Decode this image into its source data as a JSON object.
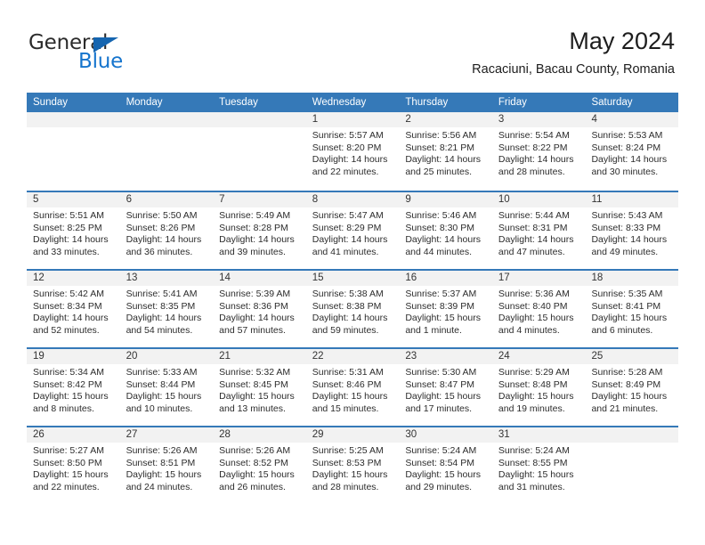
{
  "brand": {
    "name_top": "General",
    "name_bottom": "Blue",
    "triangle_color": "#1565b0",
    "blue_color": "#1574cd"
  },
  "header": {
    "title": "May 2024",
    "subtitle": "Racaciuni, Bacau County, Romania"
  },
  "theme": {
    "header_blue": "#3579b8",
    "daynum_band": "#f2f2f2",
    "text": "#2c2c2c"
  },
  "labels": {
    "sunrise_prefix": "Sunrise: ",
    "sunset_prefix": "Sunset: ",
    "daylight_prefix": "Daylight: "
  },
  "weekdays": [
    "Sunday",
    "Monday",
    "Tuesday",
    "Wednesday",
    "Thursday",
    "Friday",
    "Saturday"
  ],
  "weeks": [
    [
      {
        "day": "",
        "empty": true
      },
      {
        "day": "",
        "empty": true
      },
      {
        "day": "",
        "empty": true
      },
      {
        "day": "1",
        "sunrise": "Sunrise: 5:57 AM",
        "sunset": "Sunset: 8:20 PM",
        "daylight": "Daylight: 14 hours and 22 minutes."
      },
      {
        "day": "2",
        "sunrise": "Sunrise: 5:56 AM",
        "sunset": "Sunset: 8:21 PM",
        "daylight": "Daylight: 14 hours and 25 minutes."
      },
      {
        "day": "3",
        "sunrise": "Sunrise: 5:54 AM",
        "sunset": "Sunset: 8:22 PM",
        "daylight": "Daylight: 14 hours and 28 minutes."
      },
      {
        "day": "4",
        "sunrise": "Sunrise: 5:53 AM",
        "sunset": "Sunset: 8:24 PM",
        "daylight": "Daylight: 14 hours and 30 minutes."
      }
    ],
    [
      {
        "day": "5",
        "sunrise": "Sunrise: 5:51 AM",
        "sunset": "Sunset: 8:25 PM",
        "daylight": "Daylight: 14 hours and 33 minutes."
      },
      {
        "day": "6",
        "sunrise": "Sunrise: 5:50 AM",
        "sunset": "Sunset: 8:26 PM",
        "daylight": "Daylight: 14 hours and 36 minutes."
      },
      {
        "day": "7",
        "sunrise": "Sunrise: 5:49 AM",
        "sunset": "Sunset: 8:28 PM",
        "daylight": "Daylight: 14 hours and 39 minutes."
      },
      {
        "day": "8",
        "sunrise": "Sunrise: 5:47 AM",
        "sunset": "Sunset: 8:29 PM",
        "daylight": "Daylight: 14 hours and 41 minutes."
      },
      {
        "day": "9",
        "sunrise": "Sunrise: 5:46 AM",
        "sunset": "Sunset: 8:30 PM",
        "daylight": "Daylight: 14 hours and 44 minutes."
      },
      {
        "day": "10",
        "sunrise": "Sunrise: 5:44 AM",
        "sunset": "Sunset: 8:31 PM",
        "daylight": "Daylight: 14 hours and 47 minutes."
      },
      {
        "day": "11",
        "sunrise": "Sunrise: 5:43 AM",
        "sunset": "Sunset: 8:33 PM",
        "daylight": "Daylight: 14 hours and 49 minutes."
      }
    ],
    [
      {
        "day": "12",
        "sunrise": "Sunrise: 5:42 AM",
        "sunset": "Sunset: 8:34 PM",
        "daylight": "Daylight: 14 hours and 52 minutes."
      },
      {
        "day": "13",
        "sunrise": "Sunrise: 5:41 AM",
        "sunset": "Sunset: 8:35 PM",
        "daylight": "Daylight: 14 hours and 54 minutes."
      },
      {
        "day": "14",
        "sunrise": "Sunrise: 5:39 AM",
        "sunset": "Sunset: 8:36 PM",
        "daylight": "Daylight: 14 hours and 57 minutes."
      },
      {
        "day": "15",
        "sunrise": "Sunrise: 5:38 AM",
        "sunset": "Sunset: 8:38 PM",
        "daylight": "Daylight: 14 hours and 59 minutes."
      },
      {
        "day": "16",
        "sunrise": "Sunrise: 5:37 AM",
        "sunset": "Sunset: 8:39 PM",
        "daylight": "Daylight: 15 hours and 1 minute."
      },
      {
        "day": "17",
        "sunrise": "Sunrise: 5:36 AM",
        "sunset": "Sunset: 8:40 PM",
        "daylight": "Daylight: 15 hours and 4 minutes."
      },
      {
        "day": "18",
        "sunrise": "Sunrise: 5:35 AM",
        "sunset": "Sunset: 8:41 PM",
        "daylight": "Daylight: 15 hours and 6 minutes."
      }
    ],
    [
      {
        "day": "19",
        "sunrise": "Sunrise: 5:34 AM",
        "sunset": "Sunset: 8:42 PM",
        "daylight": "Daylight: 15 hours and 8 minutes."
      },
      {
        "day": "20",
        "sunrise": "Sunrise: 5:33 AM",
        "sunset": "Sunset: 8:44 PM",
        "daylight": "Daylight: 15 hours and 10 minutes."
      },
      {
        "day": "21",
        "sunrise": "Sunrise: 5:32 AM",
        "sunset": "Sunset: 8:45 PM",
        "daylight": "Daylight: 15 hours and 13 minutes."
      },
      {
        "day": "22",
        "sunrise": "Sunrise: 5:31 AM",
        "sunset": "Sunset: 8:46 PM",
        "daylight": "Daylight: 15 hours and 15 minutes."
      },
      {
        "day": "23",
        "sunrise": "Sunrise: 5:30 AM",
        "sunset": "Sunset: 8:47 PM",
        "daylight": "Daylight: 15 hours and 17 minutes."
      },
      {
        "day": "24",
        "sunrise": "Sunrise: 5:29 AM",
        "sunset": "Sunset: 8:48 PM",
        "daylight": "Daylight: 15 hours and 19 minutes."
      },
      {
        "day": "25",
        "sunrise": "Sunrise: 5:28 AM",
        "sunset": "Sunset: 8:49 PM",
        "daylight": "Daylight: 15 hours and 21 minutes."
      }
    ],
    [
      {
        "day": "26",
        "sunrise": "Sunrise: 5:27 AM",
        "sunset": "Sunset: 8:50 PM",
        "daylight": "Daylight: 15 hours and 22 minutes."
      },
      {
        "day": "27",
        "sunrise": "Sunrise: 5:26 AM",
        "sunset": "Sunset: 8:51 PM",
        "daylight": "Daylight: 15 hours and 24 minutes."
      },
      {
        "day": "28",
        "sunrise": "Sunrise: 5:26 AM",
        "sunset": "Sunset: 8:52 PM",
        "daylight": "Daylight: 15 hours and 26 minutes."
      },
      {
        "day": "29",
        "sunrise": "Sunrise: 5:25 AM",
        "sunset": "Sunset: 8:53 PM",
        "daylight": "Daylight: 15 hours and 28 minutes."
      },
      {
        "day": "30",
        "sunrise": "Sunrise: 5:24 AM",
        "sunset": "Sunset: 8:54 PM",
        "daylight": "Daylight: 15 hours and 29 minutes."
      },
      {
        "day": "31",
        "sunrise": "Sunrise: 5:24 AM",
        "sunset": "Sunset: 8:55 PM",
        "daylight": "Daylight: 15 hours and 31 minutes."
      },
      {
        "day": "",
        "empty": true
      }
    ]
  ]
}
